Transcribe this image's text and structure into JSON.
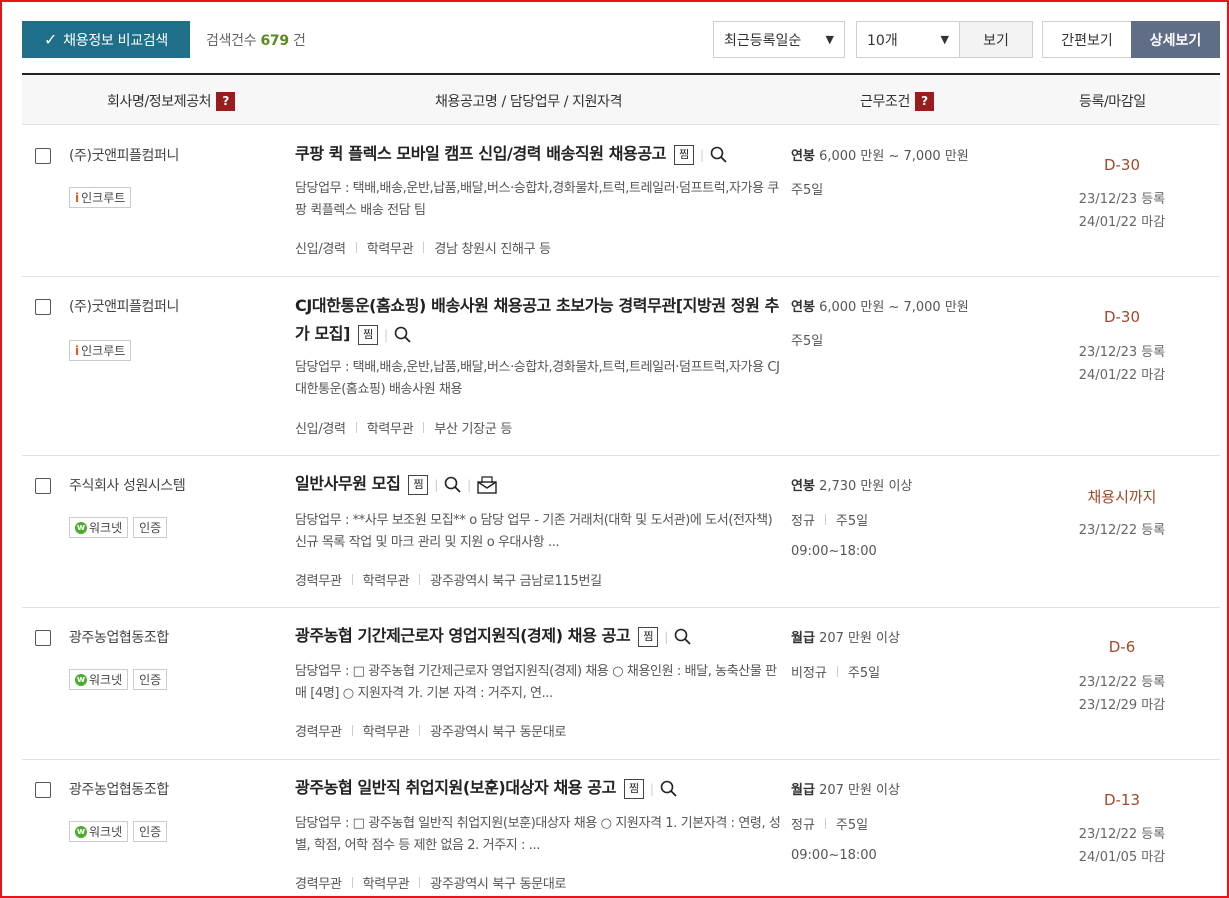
{
  "toolbar": {
    "compare_label": "채용정보 비교검색",
    "count_label": "검색건수",
    "count_value": "679",
    "count_unit": "건",
    "sort_value": "최근등록일순",
    "size_value": "10개",
    "view_label": "보기",
    "simple_label": "간편보기",
    "detail_label": "상세보기"
  },
  "header": {
    "col_company": "회사명/정보제공처",
    "col_title": "채용공고명 / 담당업무 / 지원자격",
    "col_cond": "근무조건",
    "col_date": "등록/마감일",
    "help": "?"
  },
  "rows": [
    {
      "company": "(주)굿앤피플컴퍼니",
      "source": "인크루트",
      "cert": "",
      "title": "쿠팡 퀵 플렉스 모바일 캠프 신입/경력 배송직원 채용공고",
      "scrap": "찜",
      "duty": "담당업무 : 택배,배송,운반,납품,배달,버스·승합차,경화물차,트럭,트레일러·덤프트럭,자가용 쿠팡 퀵플렉스 배송 전담 팀",
      "career": "신입/경력",
      "edu": "학력무관",
      "location": "경남 창원시 진해구 등",
      "pay_type": "연봉",
      "pay": "6,000 만원 ~ 7,000 만원",
      "emp": "",
      "days": "주5일",
      "hours": "",
      "dday": "D-30",
      "reg": "23/12/23 등록",
      "close": "24/01/22 마감"
    },
    {
      "company": "(주)굿앤피플컴퍼니",
      "source": "인크루트",
      "cert": "",
      "title": "CJ대한통운(홈쇼핑) 배송사원 채용공고 초보가능 경력무관[지방권 정원 추가 모집]",
      "scrap": "찜",
      "duty": "담당업무 : 택배,배송,운반,납품,배달,버스·승합차,경화물차,트럭,트레일러·덤프트럭,자가용 CJ대한통운(홈쇼핑) 배송사원 채용",
      "career": "신입/경력",
      "edu": "학력무관",
      "location": "부산 기장군 등",
      "pay_type": "연봉",
      "pay": "6,000 만원 ~ 7,000 만원",
      "emp": "",
      "days": "주5일",
      "hours": "",
      "dday": "D-30",
      "reg": "23/12/23 등록",
      "close": "24/01/22 마감"
    },
    {
      "company": "주식회사 성원시스템",
      "source": "워크넷",
      "cert": "인증",
      "title": "일반사무원 모집",
      "scrap": "찜",
      "duty": "담당업무 : **사무 보조원 모집** o 담당 업무 - 기존 거래처(대학 및 도서관)에 도서(전자책) 신규 목록 작업 및 마크 관리 및 지원 o 우대사항 ...",
      "career": "경력무관",
      "edu": "학력무관",
      "location": "광주광역시 북구 금남로115번길",
      "pay_type": "연봉",
      "pay": "2,730 만원 이상",
      "emp": "정규",
      "days": "주5일",
      "hours": "09:00~18:00",
      "dday": "채용시까지",
      "reg": "23/12/22 등록",
      "close": ""
    },
    {
      "company": "광주농업협동조합",
      "source": "워크넷",
      "cert": "인증",
      "title": "광주농협 기간제근로자 영업지원직(경제) 채용 공고",
      "scrap": "찜",
      "duty": "담당업무 : □ 광주농협 기간제근로자 영업지원직(경제) 채용 ○ 채용인원 : 배달, 농축산물 판매 [4명] ○ 지원자격 가. 기본 자격 : 거주지, 연...",
      "career": "경력무관",
      "edu": "학력무관",
      "location": "광주광역시 북구 동문대로",
      "pay_type": "월급",
      "pay": "207 만원 이상",
      "emp": "비정규",
      "days": "주5일",
      "hours": "",
      "dday": "D-6",
      "reg": "23/12/22 등록",
      "close": "23/12/29 마감"
    },
    {
      "company": "광주농업협동조합",
      "source": "워크넷",
      "cert": "인증",
      "title": "광주농협 일반직 취업지원(보훈)대상자 채용 공고",
      "scrap": "찜",
      "duty": "담당업무 : □ 광주농협 일반직 취업지원(보훈)대상자 채용 ○ 지원자격 1. 기본자격 : 연령, 성별, 학점, 어학 점수 등 제한 없음 2. 거주지 : ...",
      "career": "경력무관",
      "edu": "학력무관",
      "location": "광주광역시 북구 동문대로",
      "pay_type": "월급",
      "pay": "207 만원 이상",
      "emp": "정규",
      "days": "주5일",
      "hours": "09:00~18:00",
      "dday": "D-13",
      "reg": "23/12/22 등록",
      "close": "24/01/05 마감"
    }
  ]
}
